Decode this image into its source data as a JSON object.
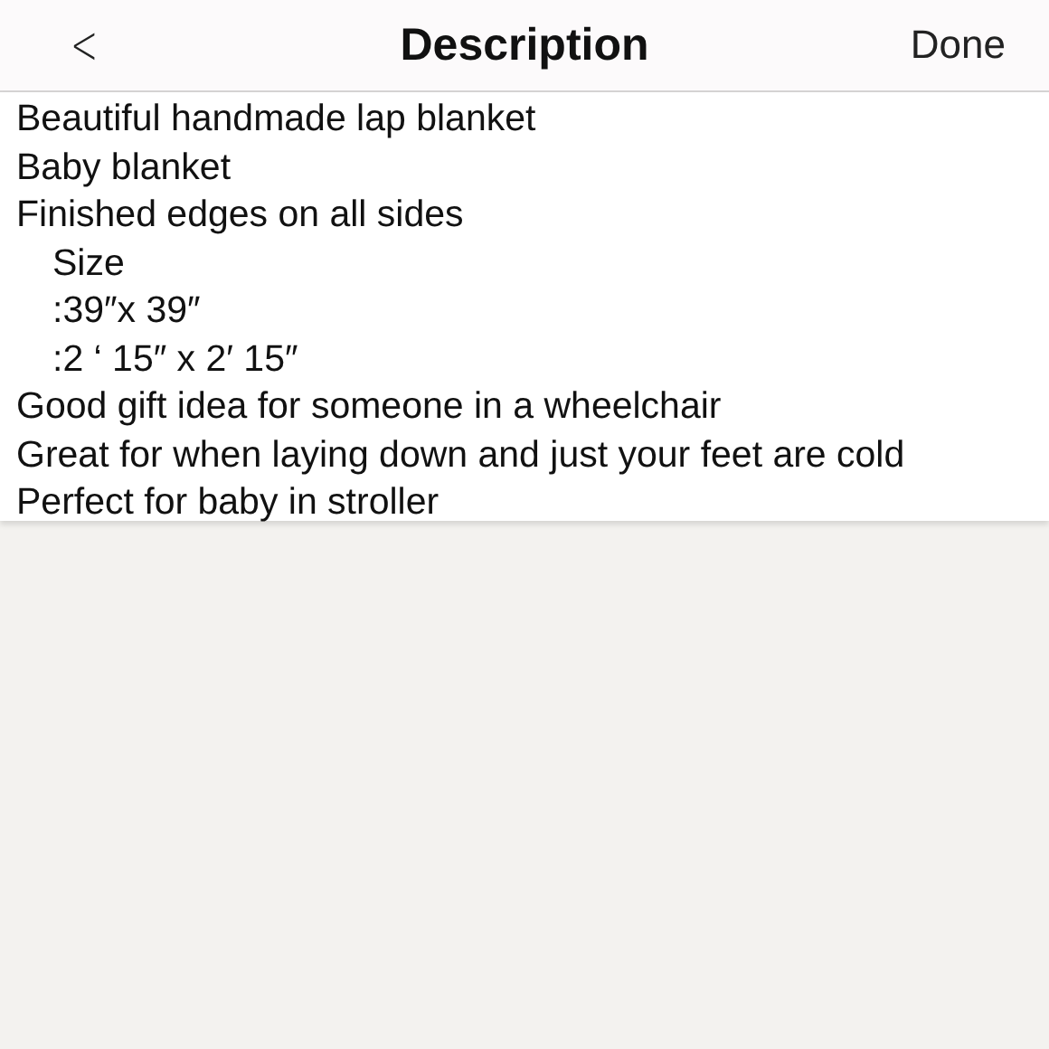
{
  "nav_bar": {
    "back": "<",
    "title": "Description",
    "done": "Done"
  },
  "description_lines": [
    {
      "text": "Beautiful handmade lap blanket",
      "kind": "plain"
    },
    {
      "text": "Baby blanket",
      "kind": "plain"
    },
    {
      "text": "Finished edges on all sides",
      "kind": "plain"
    },
    {
      "text": "Size",
      "kind": "indented"
    },
    {
      "text": ":39″x 39″",
      "kind": "indented"
    },
    {
      "text": ":2 ‘ 15″ x 2′ 15″",
      "kind": "indented"
    },
    {
      "text": "Good gift idea for someone in a wheelchair",
      "kind": "plain"
    },
    {
      "text": "Great for when laying down and just your feet are cold",
      "kind": "plain"
    },
    {
      "text": "Perfect for baby in stroller",
      "kind": "plain"
    }
  ]
}
